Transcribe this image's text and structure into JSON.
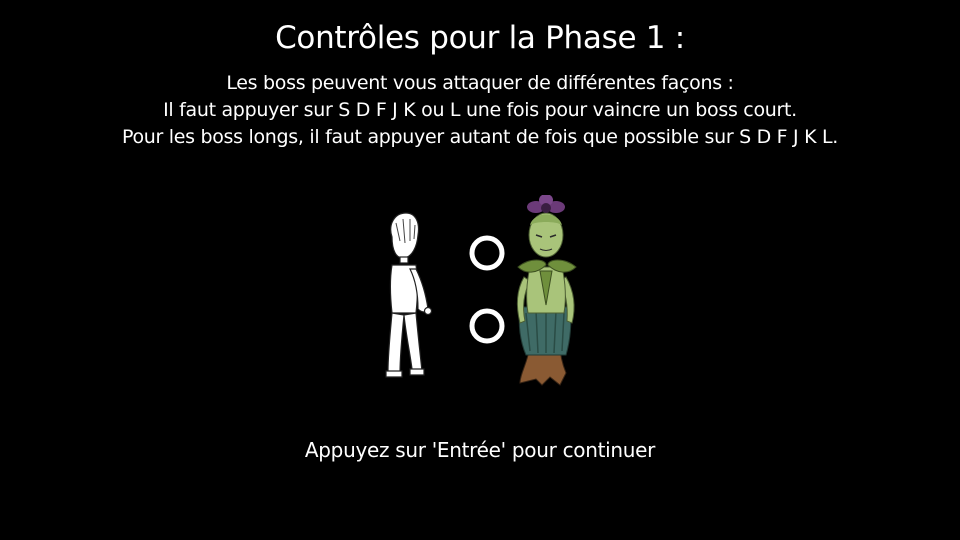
{
  "screen": {
    "title": "Contrôles pour la Phase 1 :",
    "instructions": [
      "Les boss peuvent vous attaquer de différentes façons :",
      "Il faut appuyer sur S D F J K ou L une fois pour vaincre un boss court.",
      "Pour les boss longs, il faut appuyer autant de fois que possible sur S D F J K L."
    ],
    "prompt": "Appuyez sur 'Entrée' pour continuer"
  },
  "scene": {
    "player": "player-sketch",
    "boss": "flower-boss",
    "notes": [
      "ring-note-top",
      "ring-note-bottom"
    ]
  },
  "colors": {
    "background": "#000000",
    "text": "#ffffff",
    "boss_skin": "#a9c47a",
    "boss_leaves": "#6f8f3c",
    "boss_skirt": "#3f6b66",
    "boss_roots": "#8a5a33",
    "boss_flower": "#6b3a78"
  }
}
